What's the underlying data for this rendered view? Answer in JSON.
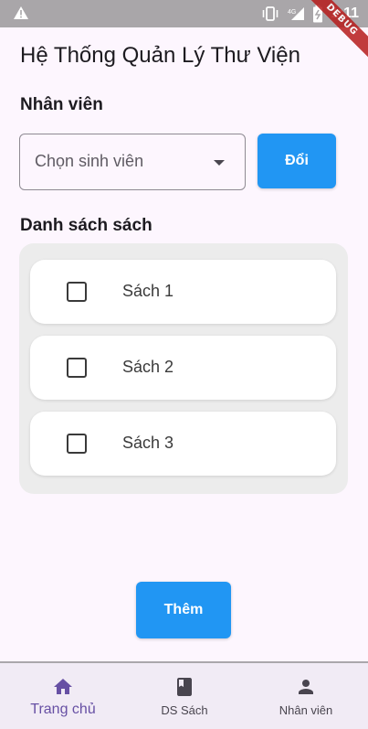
{
  "status_bar": {
    "time": "1:11",
    "network": "4G"
  },
  "debug_banner": "DEBUG",
  "app": {
    "title": "Hệ Thống Quản Lý Thư Viện"
  },
  "staff_section": {
    "label": "Nhân viên",
    "select_placeholder": "Chọn sinh viên",
    "change_button": "Đổi"
  },
  "books_section": {
    "label": "Danh sách sách",
    "items": [
      {
        "label": "Sách 1",
        "checked": false
      },
      {
        "label": "Sách 2",
        "checked": false
      },
      {
        "label": "Sách 3",
        "checked": false
      }
    ]
  },
  "add_button": "Thêm",
  "bottom_nav": {
    "active": "home",
    "items": [
      {
        "key": "home",
        "label": "Trang chủ",
        "icon": "home-icon"
      },
      {
        "key": "books",
        "label": "DS Sách",
        "icon": "book-icon"
      },
      {
        "key": "staff",
        "label": "Nhân viên",
        "icon": "person-icon"
      }
    ]
  },
  "colors": {
    "primary_button": "#2196f3",
    "nav_active": "#6750a4",
    "background": "#fdf6fe",
    "status_bar": "#a9a6a9"
  }
}
